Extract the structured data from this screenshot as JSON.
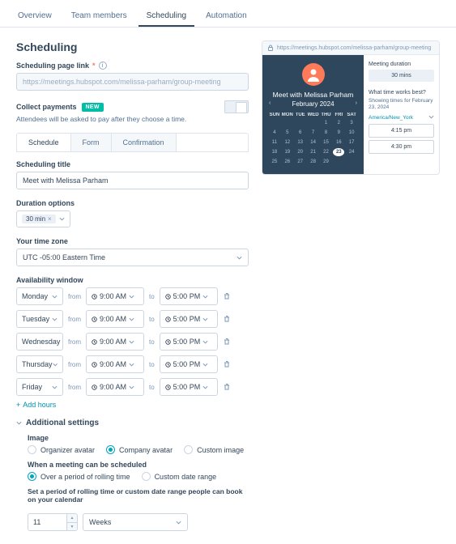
{
  "tabs": [
    "Overview",
    "Team members",
    "Scheduling",
    "Automation"
  ],
  "active_tab_index": 2,
  "heading": "Scheduling",
  "page_link": {
    "label": "Scheduling page link",
    "placeholder": "https://meetings.hubspot.com/melissa-parham/group-meeting"
  },
  "collect_payments": {
    "label": "Collect payments",
    "badge": "NEW",
    "hint": "Attendees will be asked to pay after they choose a time."
  },
  "subtabs": [
    "Schedule",
    "Form",
    "Confirmation"
  ],
  "active_subtab_index": 0,
  "title_field": {
    "label": "Scheduling title",
    "value": "Meet with Melissa Parham"
  },
  "duration": {
    "label": "Duration options",
    "chip": "30 min"
  },
  "timezone": {
    "label": "Your time zone",
    "value": "UTC -05:00 Eastern Time"
  },
  "availability": {
    "label": "Availability window",
    "from_text": "from",
    "to_text": "to",
    "rows": [
      {
        "day": "Monday",
        "from": "9:00 AM",
        "to": "5:00 PM"
      },
      {
        "day": "Tuesday",
        "from": "9:00 AM",
        "to": "5:00 PM"
      },
      {
        "day": "Wednesday",
        "from": "9:00 AM",
        "to": "5:00 PM"
      },
      {
        "day": "Thursday",
        "from": "9:00 AM",
        "to": "5:00 PM"
      },
      {
        "day": "Friday",
        "from": "9:00 AM",
        "to": "5:00 PM"
      }
    ],
    "add_hours": "Add hours"
  },
  "additional": {
    "header": "Additional settings",
    "image_label": "Image",
    "image_options": [
      "Organizer avatar",
      "Company avatar",
      "Custom image"
    ],
    "image_selected": 1,
    "schedule_label": "When a meeting can be scheduled",
    "schedule_options": [
      "Over a period of rolling time",
      "Custom date range"
    ],
    "schedule_selected": 0,
    "rolling_hint": "Set a period of rolling time or custom date range people can book on your calendar",
    "rolling_value": "11",
    "rolling_unit": "Weeks"
  },
  "preview": {
    "url": "https://meetings.hubspot.com/melissa-parham/group-meeting",
    "title": "Meet with Melissa Parham",
    "month": "February 2024",
    "dow": [
      "SUN",
      "MON",
      "TUE",
      "WED",
      "THU",
      "FRI",
      "SAT"
    ],
    "weeks": [
      [
        "",
        "",
        "",
        "",
        "1",
        "2",
        "3"
      ],
      [
        "4",
        "5",
        "6",
        "7",
        "8",
        "9",
        "10"
      ],
      [
        "11",
        "12",
        "13",
        "14",
        "15",
        "16",
        "17"
      ],
      [
        "18",
        "19",
        "20",
        "21",
        "22",
        "23",
        "24"
      ],
      [
        "25",
        "26",
        "27",
        "28",
        "29",
        "",
        ""
      ]
    ],
    "selected_day": "23",
    "duration_label": "Meeting duration",
    "duration_value": "30 mins",
    "best_label": "What time works best?",
    "showing": "Showing times for February 23, 2024",
    "tz": "America/New_York",
    "slots": [
      "4:15 pm",
      "4:30 pm"
    ]
  }
}
